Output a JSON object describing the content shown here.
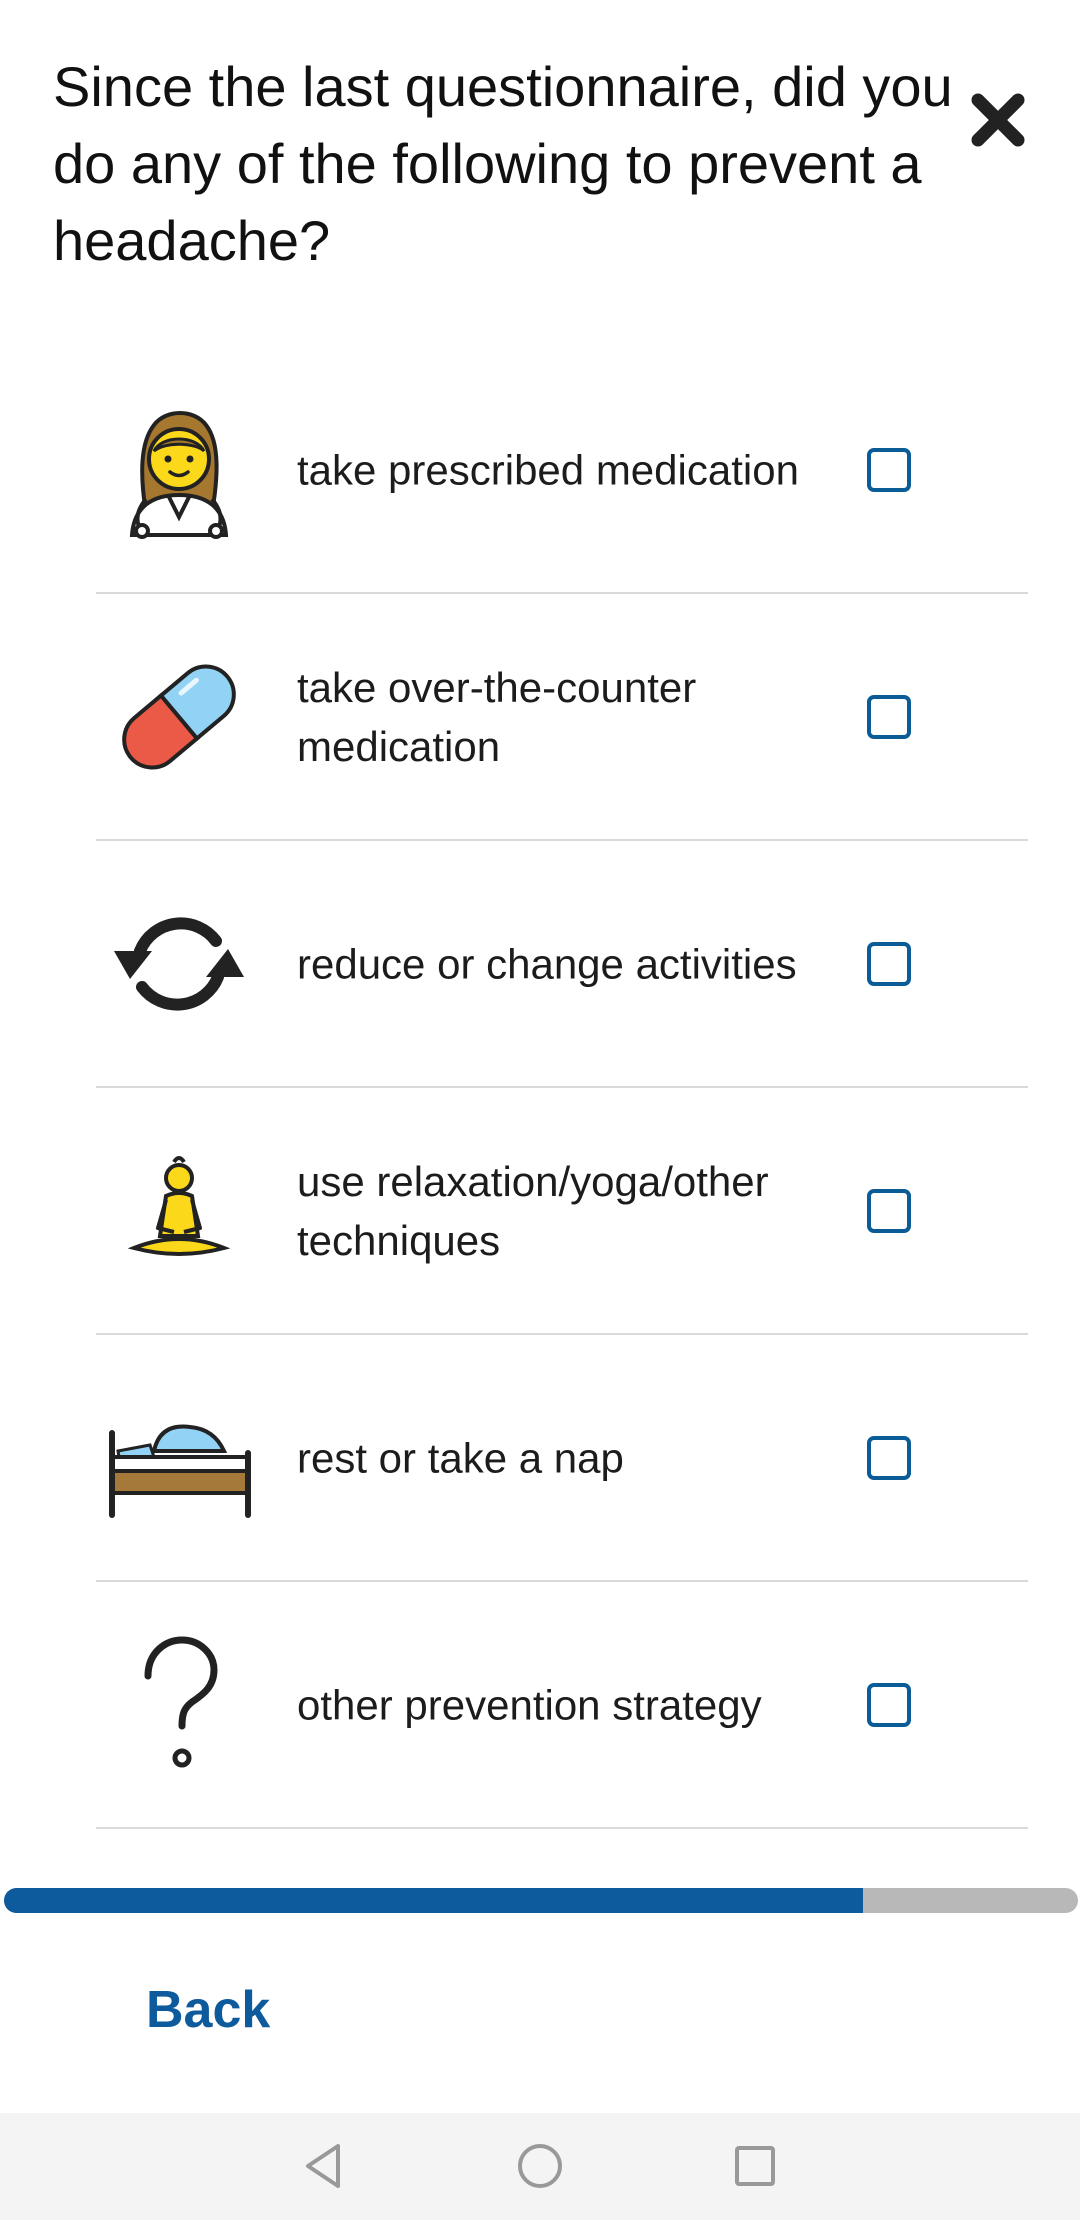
{
  "question": {
    "text": "Since the last questionnaire, did you do any of the following to prevent a headache?"
  },
  "close_icon": "close-icon",
  "options": [
    {
      "label": "take prescribed medication",
      "icon": "health-worker-icon",
      "checked": false
    },
    {
      "label": "take over-the-counter medication",
      "icon": "pill-icon",
      "checked": false
    },
    {
      "label": "reduce or change activities",
      "icon": "refresh-arrows-icon",
      "checked": false
    },
    {
      "label": "use relaxation/yoga/other techniques",
      "icon": "yoga-icon",
      "checked": false
    },
    {
      "label": "rest or take a nap",
      "icon": "bed-icon",
      "checked": false
    },
    {
      "label": "other prevention strategy",
      "icon": "question-mark-icon",
      "checked": false
    }
  ],
  "progress": {
    "fraction": 0.8
  },
  "footer": {
    "back_label": "Back"
  },
  "nav_bar": {
    "items": [
      "back-triangle-icon",
      "home-circle-icon",
      "recents-square-icon"
    ]
  },
  "colors": {
    "accent": "#0d5a9c",
    "checkbox_border": "#0a5c96",
    "progress_track": "#b8b8b8",
    "divider": "#d9d9d9"
  }
}
